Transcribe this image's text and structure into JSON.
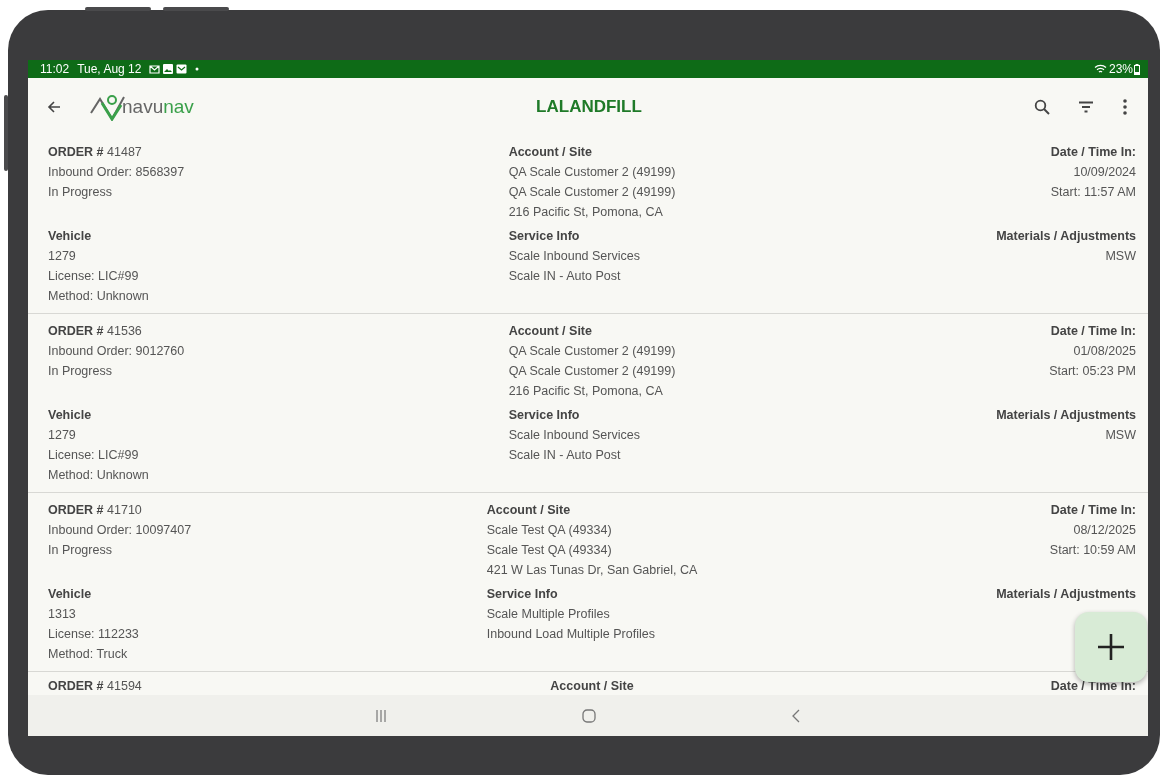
{
  "status_bar": {
    "time": "11:02",
    "date": "Tue, Aug 12",
    "battery": "23%"
  },
  "app_bar": {
    "logo_parts": [
      "navu",
      "nav"
    ],
    "title": "LALANDFILL"
  },
  "orders": [
    {
      "order": "**ORDER #** 41487",
      "order_lines": [
        "Inbound Order: 8568397",
        "In Progress"
      ],
      "account": {
        "label": "Account / Site",
        "lines": [
          "QA Scale Customer 2 (49199)",
          "QA Scale Customer 2 (49199)",
          "216 Pacific St, Pomona, CA"
        ]
      },
      "date": {
        "label": "Date / Time In:",
        "lines": [
          "10/09/2024",
          "Start: 11:57 AM"
        ]
      },
      "vehicle": {
        "label": "Vehicle",
        "lines": [
          "1279",
          "License: LIC#99",
          "Method: Unknown"
        ]
      },
      "service": {
        "label": "Service Info",
        "lines": [
          "Scale Inbound Services",
          "Scale IN - Auto Post"
        ]
      },
      "materials": {
        "label": "Materials / Adjustments",
        "lines": [
          "MSW"
        ]
      }
    },
    {
      "order": "**ORDER #** 41536",
      "order_lines": [
        "Inbound Order: 9012760",
        "In Progress"
      ],
      "account": {
        "label": "Account / Site",
        "lines": [
          "QA Scale Customer 2 (49199)",
          "QA Scale Customer 2 (49199)",
          "216 Pacific St, Pomona, CA"
        ]
      },
      "date": {
        "label": "Date / Time In:",
        "lines": [
          "01/08/2025",
          "Start: 05:23 PM"
        ]
      },
      "vehicle": {
        "label": "Vehicle",
        "lines": [
          "1279",
          "License: LIC#99",
          "Method: Unknown"
        ]
      },
      "service": {
        "label": "Service Info",
        "lines": [
          "Scale Inbound Services",
          "Scale IN - Auto Post"
        ]
      },
      "materials": {
        "label": "Materials / Adjustments",
        "lines": [
          "MSW"
        ]
      }
    },
    {
      "order": "**ORDER #** 41710",
      "order_lines": [
        "Inbound Order: 10097407",
        "In Progress"
      ],
      "account": {
        "label": "Account / Site",
        "lines": [
          "Scale Test QA (49334)",
          "Scale Test QA (49334)",
          "421 W Las Tunas Dr, San Gabriel, CA"
        ]
      },
      "date": {
        "label": "Date / Time In:",
        "lines": [
          "08/12/2025",
          "Start: 10:59 AM"
        ]
      },
      "vehicle": {
        "label": "Vehicle",
        "lines": [
          "1313",
          "License: 112233",
          "Method: Truck"
        ]
      },
      "service": {
        "label": "Service Info",
        "lines": [
          "Scale Multiple Profiles",
          "Inbound Load Multiple Profiles"
        ]
      },
      "materials": {
        "label": "Materials / Adjustments"
      }
    },
    {
      "order": "**ORDER #** 41594",
      "account": {
        "label": "Account / Site"
      },
      "date": {
        "label": "Date / Time In:"
      }
    }
  ]
}
